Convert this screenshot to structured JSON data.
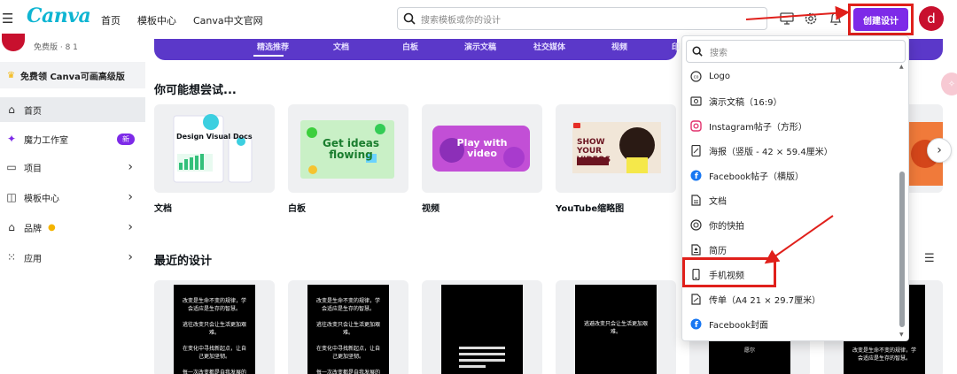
{
  "topbar": {
    "logo": "Canva",
    "nav": [
      "首页",
      "模板中心",
      "Canva中文官网"
    ],
    "search_placeholder": "搜索模板或你的设计",
    "create_label": "创建设计",
    "avatar_letter": "d"
  },
  "sidebar": {
    "account_text": "免费版 · 8 1",
    "promo": "免费领 Canva可画高级版",
    "items": [
      {
        "label": "首页",
        "icon": "home-icon"
      },
      {
        "label": "魔力工作室",
        "icon": "sparkle-icon",
        "badge": "新"
      },
      {
        "label": "项目",
        "icon": "folder-icon"
      },
      {
        "label": "模板中心",
        "icon": "template-icon"
      },
      {
        "label": "品牌",
        "icon": "brand-icon"
      },
      {
        "label": "应用",
        "icon": "apps-grid-icon"
      }
    ]
  },
  "banner": {
    "tabs": [
      "精选推荐",
      "文档",
      "白板",
      "演示文稿",
      "社交媒体",
      "视频",
      "印"
    ]
  },
  "main": {
    "try_title": "你可能想尝试...",
    "cards": [
      {
        "label": "文档",
        "thumb_text": "Design Visual Docs"
      },
      {
        "label": "白板",
        "thumb_text": "Get ideas flowing"
      },
      {
        "label": "视频",
        "thumb_text": "Play with video"
      },
      {
        "label": "YouTube缩略图",
        "thumb_text": "SHOW YOUR VIDEOS"
      }
    ],
    "recent_title": "最近的设计",
    "recent_texts": [
      "改变是生命不变的规律，学会适应是生存的智慧。\n\n逃往改变只会让生活更加艰难。\n\n在变化中寻找新起点，让自己更加坚韧。\n\n每一次改变都是自我发展的机会。",
      "改变是生命不变的规律，学会适应是生存的智慧。\n\n逃往改变只会让生活更加艰难。\n\n在变化中寻找新起点，让自己更加坚韧。\n\n每一次改变都是自我发展的机会。",
      "",
      "逃避改变只会让生活更加艰难。",
      "愿尔",
      "改变是生命不变的规律，学会适应是生存的智慧。"
    ]
  },
  "dropdown": {
    "search_placeholder": "搜索",
    "items": [
      {
        "label": "Logo",
        "icon": "logo-icon"
      },
      {
        "label": "演示文稿（16:9）",
        "icon": "presentation-icon"
      },
      {
        "label": "Instagram帖子（方形）",
        "icon": "instagram-icon"
      },
      {
        "label": "海报（竖版 - 42 × 59.4厘米）",
        "icon": "poster-icon"
      },
      {
        "label": "Facebook帖子（横版）",
        "icon": "facebook-icon"
      },
      {
        "label": "文档",
        "icon": "doc-icon"
      },
      {
        "label": "你的快拍",
        "icon": "story-icon"
      },
      {
        "label": "简历",
        "icon": "resume-icon"
      },
      {
        "label": "手机视频",
        "icon": "phone-video-icon"
      },
      {
        "label": "传单（A4 21 × 29.7厘米）",
        "icon": "flyer-icon"
      },
      {
        "label": "Facebook封面",
        "icon": "facebook-icon"
      }
    ]
  },
  "colors": {
    "brand": "#7d2ae8",
    "annotation": "#e0201b",
    "banner": "#5b38c9",
    "avatar": "#c8102e"
  }
}
